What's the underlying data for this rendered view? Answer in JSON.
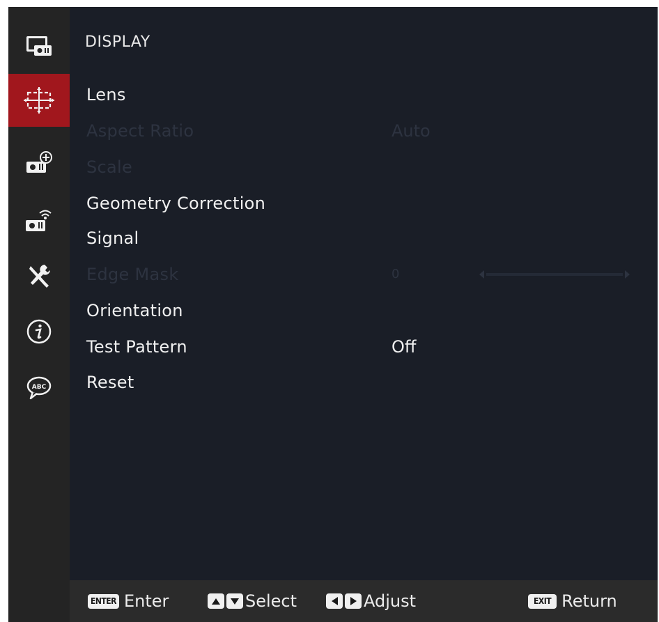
{
  "sidebar": {
    "items": [
      {
        "icon": "picture-settings-icon",
        "active": false
      },
      {
        "icon": "display-geometry-icon",
        "active": true
      },
      {
        "icon": "projector-add-icon",
        "active": false
      },
      {
        "icon": "projector-network-icon",
        "active": false
      },
      {
        "icon": "tools-icon",
        "active": false
      },
      {
        "icon": "info-icon",
        "active": false
      },
      {
        "icon": "language-abc-icon",
        "active": false
      }
    ]
  },
  "menu": {
    "title": "DISPLAY",
    "items": [
      {
        "label": "Lens",
        "value": "",
        "enabled": true
      },
      {
        "label": "Aspect Ratio",
        "value": "Auto",
        "enabled": false
      },
      {
        "label": "Scale",
        "value": "",
        "enabled": false
      },
      {
        "label": "Geometry Correction",
        "value": "",
        "enabled": true
      },
      {
        "label": "Signal",
        "value": "",
        "enabled": true
      },
      {
        "label": "Edge Mask",
        "value": "0",
        "enabled": false,
        "slider": 0
      },
      {
        "label": "Orientation",
        "value": "",
        "enabled": true
      },
      {
        "label": "Test Pattern",
        "value": "Off",
        "enabled": true
      },
      {
        "label": "Reset",
        "value": "",
        "enabled": true
      }
    ]
  },
  "footer": {
    "enter_key": "ENTER",
    "enter_label": "Enter",
    "select_label": "Select",
    "adjust_label": "Adjust",
    "exit_key": "EXIT",
    "return_label": "Return"
  },
  "colors": {
    "background": "#1a1e27",
    "sidebar": "#242424",
    "active": "#a1171d",
    "footer": "#2b2b2b",
    "text": "#f0f0f0",
    "disabled_text": "#2d3340"
  }
}
